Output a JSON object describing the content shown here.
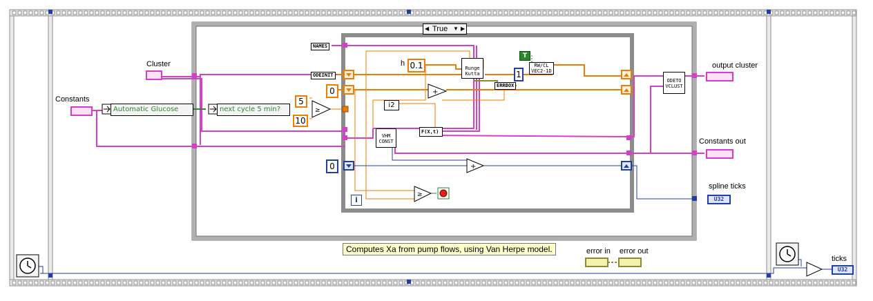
{
  "case_selector": {
    "value": "True"
  },
  "free_labels": {
    "cluster": "Cluster",
    "constants": "Constants",
    "output_cluster": "output cluster",
    "constants_out": "Constants out",
    "spline_ticks": "spline ticks",
    "error_in": "error in",
    "error_out": "error out",
    "ticks": "ticks",
    "h": "h"
  },
  "constants": {
    "h_value": "0.1",
    "zero_a": "0",
    "five": "5",
    "ten": "10",
    "zero_b": "0",
    "one": "1",
    "true_const": "T"
  },
  "rings": {
    "automatic_glucose": "Automatic Glucose",
    "next_cycle": "next cycle 5 min?"
  },
  "bundle_labels": {
    "names": "NAMES",
    "odeinit": "ODEINIT",
    "errbox": "ERRBOX",
    "i2": "i2",
    "fxt": "F(X,t)"
  },
  "subvis": {
    "runge_kutta": "Runge Kutta",
    "vhm_const": "VHM CONST",
    "rw_cl": "RW/CL VEC2-1D",
    "odeto_vclust": "ODETO VCLUST"
  },
  "iteration": {
    "label": "i"
  },
  "indicators": {
    "u32": "U32"
  },
  "comment": "Computes Xa from pump flows, using Van Herpe model.",
  "colors": {
    "cluster_wire": "#d63ec8",
    "numeric_wire": "#f07c00",
    "int_wire": "#1f3ea8",
    "boolean_wire": "#2a8a2a",
    "structure": "#8c8c8c"
  }
}
